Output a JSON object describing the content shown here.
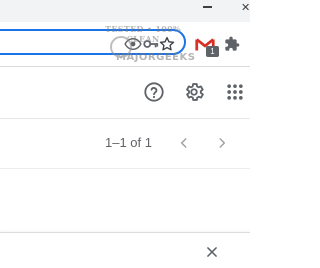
{
  "window": {
    "minimize_icon": "minimize-icon",
    "close_icon": "close-icon"
  },
  "toolbar": {
    "omnibox_value": "",
    "icons": [
      "eye-icon",
      "key-icon",
      "star-icon",
      "gmail-extension-icon",
      "puzzle-icon"
    ],
    "extension_badge": "1",
    "accent_color": "#1a73e8",
    "gmail_red": "#d93025"
  },
  "watermark": {
    "top_text": "TESTED • 100% CLEAN",
    "bottom_text": "MAJORGEEKS"
  },
  "app_header": {
    "icons": [
      "help-icon",
      "settings-icon",
      "apps-grid-icon"
    ]
  },
  "pagination": {
    "range_text": "1–1 of 1",
    "prev_icon": "chevron-left-icon",
    "next_icon": "chevron-right-icon"
  },
  "card": {
    "close_icon": "close-icon"
  }
}
